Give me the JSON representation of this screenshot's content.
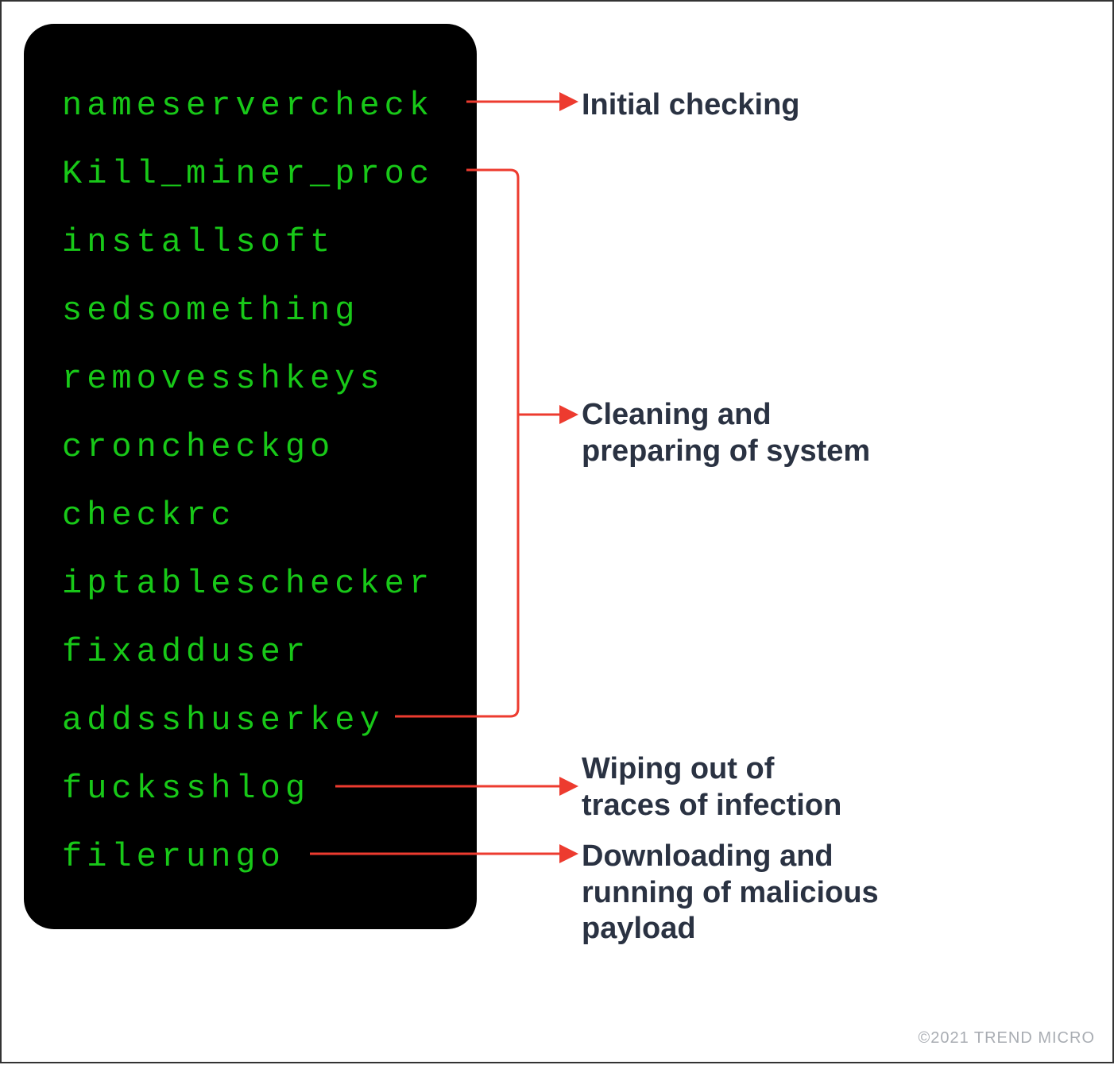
{
  "terminal": {
    "lines": [
      "nameservercheck",
      "Kill_miner_proc",
      "installsoft",
      "sedsomething",
      "removesshkeys",
      "croncheckgo",
      "checkrc",
      "iptableschecker",
      "fixadduser",
      "addsshuserkey",
      "fucksshlog",
      "filerungo"
    ]
  },
  "annotations": {
    "initial": "Initial checking",
    "cleaning_line1": "Cleaning and",
    "cleaning_line2": "preparing of system",
    "wiping_line1": "Wiping out of",
    "wiping_line2": "traces of infection",
    "download_line1": "Downloading and",
    "download_line2": "running of malicious",
    "download_line3": "payload"
  },
  "copyright": "©2021 TREND MICRO",
  "colors": {
    "terminal_bg": "#000000",
    "terminal_text": "#18c818",
    "arrow": "#ed3b2f",
    "label": "#2a3242"
  }
}
